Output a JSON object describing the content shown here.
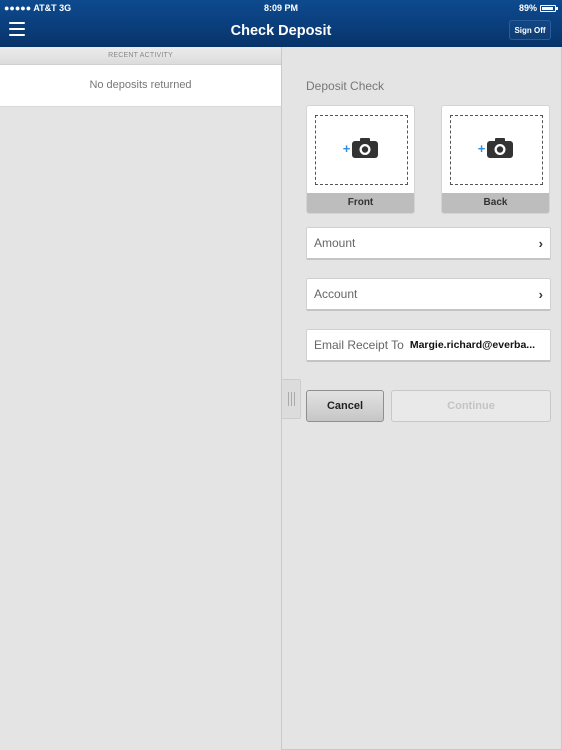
{
  "status_bar": {
    "carrier": "●●●●● AT&T  3G",
    "time": "8:09 PM",
    "battery": "89%"
  },
  "header": {
    "title": "Check Deposit",
    "menu_icon": "hamburger-menu-icon",
    "sign_off_label": "Sign Off"
  },
  "recent_activity": {
    "heading": "RECENT ACTIVITY",
    "empty_message": "No deposits returned"
  },
  "deposit": {
    "title": "Deposit Check",
    "front_label": "Front",
    "back_label": "Back",
    "camera_icon": "add-camera-icon",
    "amount_label": "Amount",
    "account_label": "Account",
    "email_label": "Email Receipt To",
    "email_value": "Margie.richard@everba...",
    "cancel_label": "Cancel",
    "continue_label": "Continue"
  },
  "colors": {
    "header_blue": "#0a3d7a",
    "accent_plus": "#2f8fe0",
    "background": "#e4e4e4"
  }
}
